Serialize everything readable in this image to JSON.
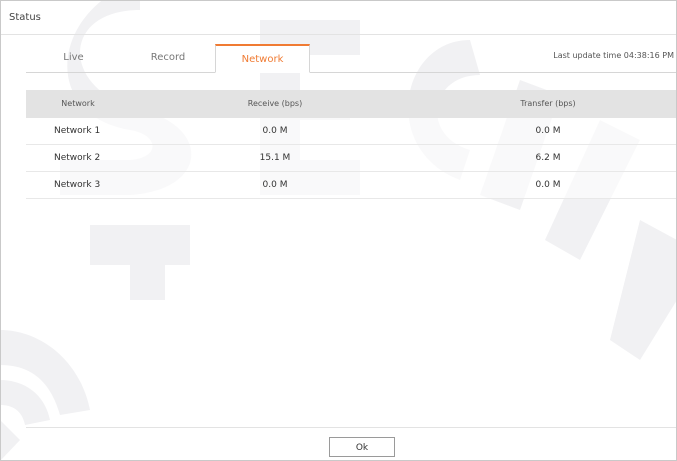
{
  "dialog": {
    "title": "Status"
  },
  "tabs": [
    {
      "label": "Live",
      "active": false
    },
    {
      "label": "Record",
      "active": false
    },
    {
      "label": "Network",
      "active": true
    }
  ],
  "last_update": "Last update time 04:38:16 PM",
  "table": {
    "headers": [
      "Network",
      "Receive (bps)",
      "Transfer (bps)"
    ],
    "rows": [
      {
        "network": "Network 1",
        "receive": "0.0 M",
        "transfer": "0.0 M"
      },
      {
        "network": "Network 2",
        "receive": "15.1 M",
        "transfer": "6.2 M"
      },
      {
        "network": "Network 3",
        "receive": "0.0 M",
        "transfer": "0.0 M"
      }
    ]
  },
  "footer": {
    "ok_label": "Ok"
  },
  "colors": {
    "accent": "#f07b33",
    "header_bg": "#e3e3e3"
  }
}
